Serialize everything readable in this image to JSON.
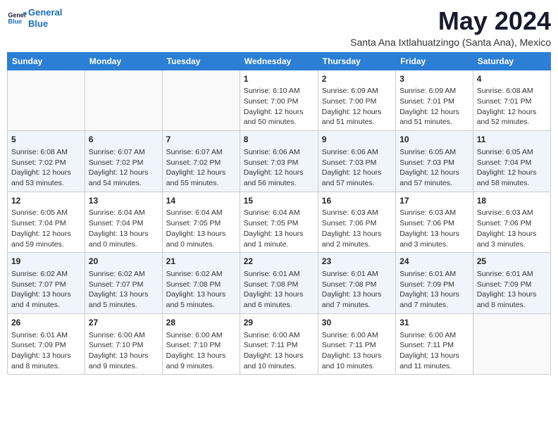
{
  "header": {
    "logo_line1": "General",
    "logo_line2": "Blue",
    "month_title": "May 2024",
    "subtitle": "Santa Ana Ixtlahuatzingo (Santa Ana), Mexico"
  },
  "weekdays": [
    "Sunday",
    "Monday",
    "Tuesday",
    "Wednesday",
    "Thursday",
    "Friday",
    "Saturday"
  ],
  "weeks": [
    [
      {
        "day": "",
        "info": ""
      },
      {
        "day": "",
        "info": ""
      },
      {
        "day": "",
        "info": ""
      },
      {
        "day": "1",
        "info": "Sunrise: 6:10 AM\nSunset: 7:00 PM\nDaylight: 12 hours\nand 50 minutes."
      },
      {
        "day": "2",
        "info": "Sunrise: 6:09 AM\nSunset: 7:00 PM\nDaylight: 12 hours\nand 51 minutes."
      },
      {
        "day": "3",
        "info": "Sunrise: 6:09 AM\nSunset: 7:01 PM\nDaylight: 12 hours\nand 51 minutes."
      },
      {
        "day": "4",
        "info": "Sunrise: 6:08 AM\nSunset: 7:01 PM\nDaylight: 12 hours\nand 52 minutes."
      }
    ],
    [
      {
        "day": "5",
        "info": "Sunrise: 6:08 AM\nSunset: 7:02 PM\nDaylight: 12 hours\nand 53 minutes."
      },
      {
        "day": "6",
        "info": "Sunrise: 6:07 AM\nSunset: 7:02 PM\nDaylight: 12 hours\nand 54 minutes."
      },
      {
        "day": "7",
        "info": "Sunrise: 6:07 AM\nSunset: 7:02 PM\nDaylight: 12 hours\nand 55 minutes."
      },
      {
        "day": "8",
        "info": "Sunrise: 6:06 AM\nSunset: 7:03 PM\nDaylight: 12 hours\nand 56 minutes."
      },
      {
        "day": "9",
        "info": "Sunrise: 6:06 AM\nSunset: 7:03 PM\nDaylight: 12 hours\nand 57 minutes."
      },
      {
        "day": "10",
        "info": "Sunrise: 6:05 AM\nSunset: 7:03 PM\nDaylight: 12 hours\nand 57 minutes."
      },
      {
        "day": "11",
        "info": "Sunrise: 6:05 AM\nSunset: 7:04 PM\nDaylight: 12 hours\nand 58 minutes."
      }
    ],
    [
      {
        "day": "12",
        "info": "Sunrise: 6:05 AM\nSunset: 7:04 PM\nDaylight: 12 hours\nand 59 minutes."
      },
      {
        "day": "13",
        "info": "Sunrise: 6:04 AM\nSunset: 7:04 PM\nDaylight: 13 hours\nand 0 minutes."
      },
      {
        "day": "14",
        "info": "Sunrise: 6:04 AM\nSunset: 7:05 PM\nDaylight: 13 hours\nand 0 minutes."
      },
      {
        "day": "15",
        "info": "Sunrise: 6:04 AM\nSunset: 7:05 PM\nDaylight: 13 hours\nand 1 minute."
      },
      {
        "day": "16",
        "info": "Sunrise: 6:03 AM\nSunset: 7:06 PM\nDaylight: 13 hours\nand 2 minutes."
      },
      {
        "day": "17",
        "info": "Sunrise: 6:03 AM\nSunset: 7:06 PM\nDaylight: 13 hours\nand 3 minutes."
      },
      {
        "day": "18",
        "info": "Sunrise: 6:03 AM\nSunset: 7:06 PM\nDaylight: 13 hours\nand 3 minutes."
      }
    ],
    [
      {
        "day": "19",
        "info": "Sunrise: 6:02 AM\nSunset: 7:07 PM\nDaylight: 13 hours\nand 4 minutes."
      },
      {
        "day": "20",
        "info": "Sunrise: 6:02 AM\nSunset: 7:07 PM\nDaylight: 13 hours\nand 5 minutes."
      },
      {
        "day": "21",
        "info": "Sunrise: 6:02 AM\nSunset: 7:08 PM\nDaylight: 13 hours\nand 5 minutes."
      },
      {
        "day": "22",
        "info": "Sunrise: 6:01 AM\nSunset: 7:08 PM\nDaylight: 13 hours\nand 6 minutes."
      },
      {
        "day": "23",
        "info": "Sunrise: 6:01 AM\nSunset: 7:08 PM\nDaylight: 13 hours\nand 7 minutes."
      },
      {
        "day": "24",
        "info": "Sunrise: 6:01 AM\nSunset: 7:09 PM\nDaylight: 13 hours\nand 7 minutes."
      },
      {
        "day": "25",
        "info": "Sunrise: 6:01 AM\nSunset: 7:09 PM\nDaylight: 13 hours\nand 8 minutes."
      }
    ],
    [
      {
        "day": "26",
        "info": "Sunrise: 6:01 AM\nSunset: 7:09 PM\nDaylight: 13 hours\nand 8 minutes."
      },
      {
        "day": "27",
        "info": "Sunrise: 6:00 AM\nSunset: 7:10 PM\nDaylight: 13 hours\nand 9 minutes."
      },
      {
        "day": "28",
        "info": "Sunrise: 6:00 AM\nSunset: 7:10 PM\nDaylight: 13 hours\nand 9 minutes."
      },
      {
        "day": "29",
        "info": "Sunrise: 6:00 AM\nSunset: 7:11 PM\nDaylight: 13 hours\nand 10 minutes."
      },
      {
        "day": "30",
        "info": "Sunrise: 6:00 AM\nSunset: 7:11 PM\nDaylight: 13 hours\nand 10 minutes."
      },
      {
        "day": "31",
        "info": "Sunrise: 6:00 AM\nSunset: 7:11 PM\nDaylight: 13 hours\nand 11 minutes."
      },
      {
        "day": "",
        "info": ""
      }
    ]
  ]
}
